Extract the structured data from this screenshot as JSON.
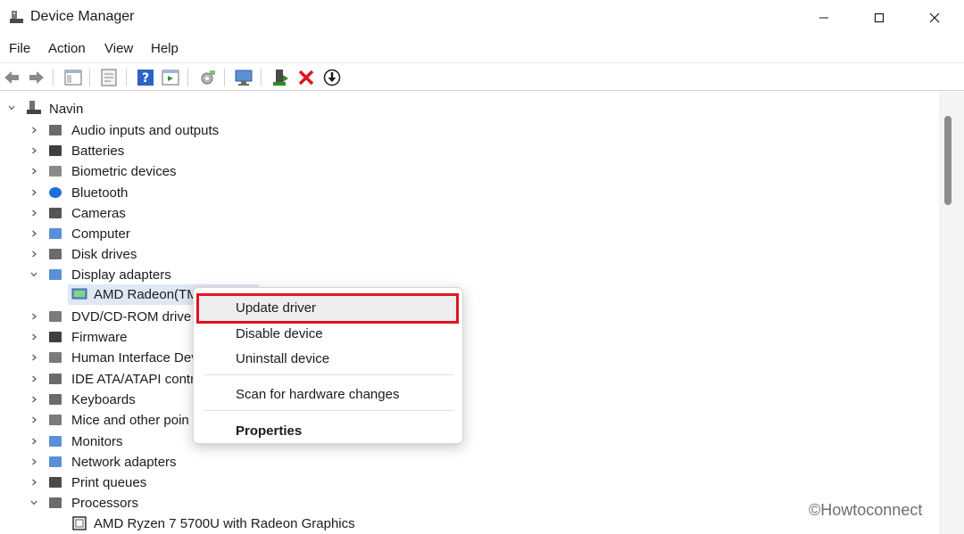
{
  "window": {
    "title": "Device Manager"
  },
  "menubar": {
    "items": [
      "File",
      "Action",
      "View",
      "Help"
    ]
  },
  "tree": {
    "root": "Navin",
    "categories": [
      "Audio inputs and outputs",
      "Batteries",
      "Biometric devices",
      "Bluetooth",
      "Cameras",
      "Computer",
      "Disk drives",
      "Display adapters",
      "DVD/CD-ROM drive",
      "Firmware",
      "Human Interface Dev",
      "IDE ATA/ATAPI contro",
      "Keyboards",
      "Mice and other poin",
      "Monitors",
      "Network adapters",
      "Print queues",
      "Processors"
    ],
    "display_child": "AMD Radeon(TM",
    "processor_child": "AMD Ryzen 7 5700U with Radeon Graphics"
  },
  "context_menu": {
    "items": [
      "Update driver",
      "Disable device",
      "Uninstall device",
      "Scan for hardware changes",
      "Properties"
    ],
    "highlighted": "Update driver"
  },
  "watermark": "©Howtoconnect",
  "colors": {
    "highlight_border": "#e0151f",
    "delete_icon": "#e0151f",
    "selection": "#dfe8f5"
  }
}
